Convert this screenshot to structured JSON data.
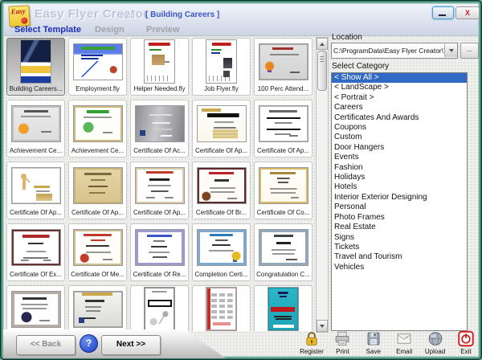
{
  "window": {
    "logo_text": "Easy",
    "title": "Easy Flyer Creator",
    "version": "V3.0",
    "subtitle": "[ Building Careers ]",
    "close_label": "X"
  },
  "tabs": [
    {
      "label": "Select Template",
      "active": true
    },
    {
      "label": "Design",
      "active": false
    },
    {
      "label": "Preview",
      "active": false
    }
  ],
  "location": {
    "label": "Location",
    "value": "C:\\ProgramData\\Easy Flyer Creator\\Templates",
    "browse_label": "..."
  },
  "category": {
    "label": "Select Category",
    "selected": "< Show All >",
    "items": [
      "< Show All >",
      "< LandScape >",
      "< Portrait >",
      "Careers",
      "Certificates And Awards",
      "Coupons",
      "Custom",
      "Door Hangers",
      "Events",
      "Fashion",
      "Holidays",
      "Hotels",
      "Interior Exterior Designing",
      "Personal",
      "Photo Frames",
      "Real Estate",
      "Signs",
      "Tickets",
      "Travel and Tourism",
      "Vehicles"
    ]
  },
  "templates": [
    {
      "label": "Building Careers...",
      "preview": "building-careers-flyer",
      "orientation": "portrait",
      "selected": true
    },
    {
      "label": "Employment.fly",
      "preview": "employment-flyer",
      "orientation": "landscape"
    },
    {
      "label": "Helper Needed.fly",
      "preview": "helper-needed-flyer",
      "orientation": "portrait"
    },
    {
      "label": "Job Flyer.fly",
      "preview": "job-flyer",
      "orientation": "portrait"
    },
    {
      "label": "100 Perc Attend...",
      "preview": "attendance-certificate",
      "orientation": "landscape"
    },
    {
      "label": "Achievement Ce...",
      "preview": "achievement-certificate-gray",
      "orientation": "landscape"
    },
    {
      "label": "Achievement Ce...",
      "preview": "achievement-certificate-green",
      "orientation": "landscape"
    },
    {
      "label": "Certificate Of Ac...",
      "preview": "certificate-silver",
      "orientation": "landscape"
    },
    {
      "label": "Certificate Of Ap...",
      "preview": "certificate-gold-banner",
      "orientation": "landscape"
    },
    {
      "label": "Certificate Of Ap...",
      "preview": "certificate-plain",
      "orientation": "landscape"
    },
    {
      "label": "Certificate Of Ap...",
      "preview": "certificate-figure",
      "orientation": "landscape"
    },
    {
      "label": "Certificate Of Ap...",
      "preview": "certificate-tan",
      "orientation": "landscape"
    },
    {
      "label": "Certificate Of Ap...",
      "preview": "certificate-red-title",
      "orientation": "landscape"
    },
    {
      "label": "Certificate Of Br...",
      "preview": "certificate-bravery",
      "orientation": "landscape"
    },
    {
      "label": "Certificate Of Co...",
      "preview": "certificate-compliance",
      "orientation": "landscape"
    },
    {
      "label": "Certificate Of Ex...",
      "preview": "certificate-excellence",
      "orientation": "landscape"
    },
    {
      "label": "Certificate Of Me...",
      "preview": "certificate-merit",
      "orientation": "landscape"
    },
    {
      "label": "Certificate Of Re...",
      "preview": "certificate-recognition",
      "orientation": "landscape"
    },
    {
      "label": "Completion Certi...",
      "preview": "completion-certificate",
      "orientation": "landscape"
    },
    {
      "label": "Congratulation C...",
      "preview": "congratulation-certificate",
      "orientation": "landscape"
    },
    {
      "label": "",
      "preview": "university-certificate",
      "orientation": "landscape"
    },
    {
      "label": "",
      "preview": "employee-month-certificate",
      "orientation": "landscape"
    },
    {
      "label": "",
      "preview": "sports-award-flyer",
      "orientation": "portrait"
    },
    {
      "label": "",
      "preview": "coupon-sheet-flyer",
      "orientation": "portrait"
    },
    {
      "label": "",
      "preview": "special-offer-flyer",
      "orientation": "portrait"
    }
  ],
  "footer": {
    "back_label": "<< Back",
    "help_label": "?",
    "next_label": "Next >>"
  },
  "toolbar": [
    {
      "label": "Register",
      "icon": "lock-icon"
    },
    {
      "label": "Print",
      "icon": "printer-icon"
    },
    {
      "label": "Save",
      "icon": "floppy-icon"
    },
    {
      "label": "Email",
      "icon": "envelope-icon"
    },
    {
      "label": "Upload",
      "icon": "globe-icon"
    },
    {
      "label": "Exit",
      "icon": "power-icon"
    }
  ],
  "colors": {
    "selection_blue": "#316ac5",
    "active_tab_blue": "#1f2fb4",
    "frame_teal": "#2f6e5e",
    "exit_red": "#cc2020",
    "logo_yellow": "#f0c832"
  }
}
